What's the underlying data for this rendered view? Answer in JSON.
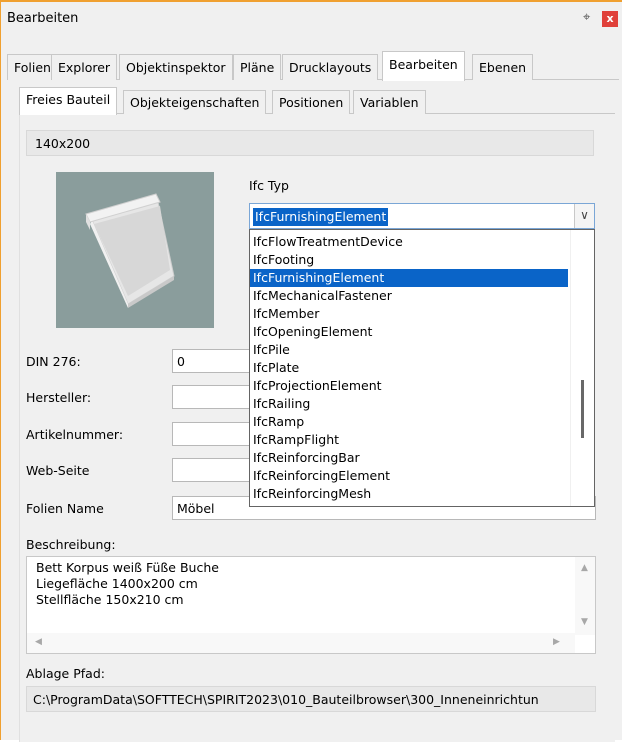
{
  "window": {
    "title": "Bearbeiten"
  },
  "tabs": [
    {
      "label": "Folien"
    },
    {
      "label": "Explorer"
    },
    {
      "label": "Objektinspektor"
    },
    {
      "label": "Pläne"
    },
    {
      "label": "Drucklayouts"
    },
    {
      "label": "Bearbeiten"
    },
    {
      "label": "Ebenen"
    }
  ],
  "active_tab": "Bearbeiten",
  "subtabs": [
    {
      "label": "Freies Bauteil"
    },
    {
      "label": "Objekteigenschaften"
    },
    {
      "label": "Positionen"
    },
    {
      "label": "Variablen"
    }
  ],
  "active_subtab": "Freies Bauteil",
  "part": {
    "name": "140x200"
  },
  "ifc": {
    "label": "Ifc Typ",
    "selected": "IfcFurnishingElement",
    "options": [
      "IfcFlowTreatmentDevice",
      "IfcFooting",
      "IfcFurnishingElement",
      "IfcMechanicalFastener",
      "IfcMember",
      "IfcOpeningElement",
      "IfcPile",
      "IfcPlate",
      "IfcProjectionElement",
      "IfcRailing",
      "IfcRamp",
      "IfcRampFlight",
      "IfcReinforcingBar",
      "IfcReinforcingElement",
      "IfcReinforcingMesh"
    ]
  },
  "fields": {
    "din_label": "DIN 276:",
    "din_value": "0",
    "hersteller_label": "Hersteller:",
    "hersteller_value": "",
    "artikel_label": "Artikelnummer:",
    "artikel_value": "",
    "web_label": "Web-Seite",
    "web_value": "",
    "folien_label": "Folien Name",
    "folien_value": "Möbel"
  },
  "beschreibung": {
    "label": "Beschreibung:",
    "text": "Bett Korpus weiß Füße Buche\nLiegefläche 1400x200 cm\nStellfläche 150x210 cm"
  },
  "ablage": {
    "label": "Ablage Pfad:",
    "value": "C:\\ProgramData\\SOFTTECH\\SPIRIT2023\\010_Bauteilbrowser\\300_Inneneinrichtun"
  },
  "colors": {
    "selection": "#0a64c8",
    "accent_border": "#f0a030",
    "close": "#e0403a",
    "preview_bg": "#8a9d9c"
  },
  "icons": {
    "pin": "pin-icon",
    "close": "close-icon",
    "dropdown": "chevron-down-icon"
  }
}
